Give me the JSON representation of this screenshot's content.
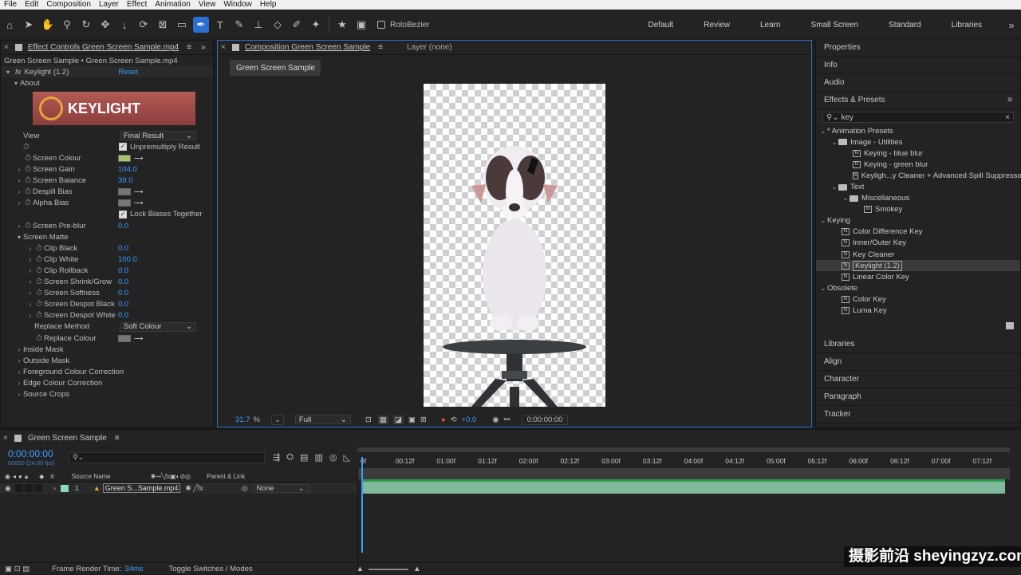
{
  "menu": [
    "File",
    "Edit",
    "Composition",
    "Layer",
    "Effect",
    "Animation",
    "View",
    "Window",
    "Help"
  ],
  "toolbar": {
    "rotobezier_label": "RotoBezier",
    "workspaces": [
      "Default",
      "Review",
      "Learn",
      "Small Screen",
      "Standard",
      "Libraries"
    ]
  },
  "effect_controls": {
    "tab_title": "Effect Controls Green Screen Sample.mp4",
    "subtitle": "Green Screen Sample • Green Screen Sample.mp4",
    "effect_name": "Keylight (1.2)",
    "reset_label": "Reset",
    "about_label": "About",
    "banner_text": "KEYLIGHT",
    "view_label": "View",
    "view_value": "Final Result",
    "unpremultiply_label": "Unpremultiply Result",
    "screen_colour_label": "Screen Colour",
    "screen_colour_swatch": "#a8c46a",
    "screen_gain_label": "Screen Gain",
    "screen_gain_value": "104.0",
    "screen_balance_label": "Screen Balance",
    "screen_balance_value": "39.0",
    "despill_bias_label": "Despill Bias",
    "alpha_bias_label": "Alpha Bias",
    "lock_biases_label": "Lock Biases Together",
    "screen_preblur_label": "Screen Pre-blur",
    "screen_preblur_value": "0.0",
    "screen_matte_label": "Screen Matte",
    "clip_black_label": "Clip Black",
    "clip_black_value": "0.0",
    "clip_white_label": "Clip White",
    "clip_white_value": "100.0",
    "clip_rollback_label": "Clip Rollback",
    "clip_rollback_value": "0.0",
    "shrink_grow_label": "Screen Shrink/Grow",
    "shrink_grow_value": "0.0",
    "softness_label": "Screen Softness",
    "softness_value": "0.0",
    "despot_black_label": "Screen Despot Black",
    "despot_black_value": "0.0",
    "despot_white_label": "Screen Despot White",
    "despot_white_value": "0.0",
    "replace_method_label": "Replace Method",
    "replace_method_value": "Soft Colour",
    "replace_colour_label": "Replace Colour",
    "groups": [
      "Inside Mask",
      "Outside Mask",
      "Foreground Colour Correction",
      "Edge Colour Correction",
      "Source Crops"
    ]
  },
  "composition": {
    "tab_title": "Composition Green Screen Sample",
    "layer_tab": "Layer (none)",
    "comp_button": "Green Screen Sample",
    "zoom": "31.7",
    "zoom_unit": "%",
    "resolution": "Full",
    "exposure": "+0.0",
    "timecode": "0:00:00:00"
  },
  "right_panel": {
    "sections_top": [
      "Properties",
      "Info",
      "Audio"
    ],
    "effects_title": "Effects & Presets",
    "search_value": "key",
    "tree": [
      {
        "label": "* Animation Presets",
        "level": 0,
        "kind": "group"
      },
      {
        "label": "Image - Utilities",
        "level": 1,
        "kind": "folder"
      },
      {
        "label": "Keying - blue blur",
        "level": 2,
        "kind": "fx"
      },
      {
        "label": "Keying - green blur",
        "level": 2,
        "kind": "fx"
      },
      {
        "label": "Keyligh...y Cleaner + Advanced Spill Suppressor",
        "level": 2,
        "kind": "fx"
      },
      {
        "label": "Text",
        "level": 1,
        "kind": "folder"
      },
      {
        "label": "Miscellaneous",
        "level": 2,
        "kind": "folder"
      },
      {
        "label": "Smokey",
        "level": 3,
        "kind": "fx"
      },
      {
        "label": "Keying",
        "level": 0,
        "kind": "group"
      },
      {
        "label": "Color Difference Key",
        "level": 1,
        "kind": "fx"
      },
      {
        "label": "Inner/Outer Key",
        "level": 1,
        "kind": "fx"
      },
      {
        "label": "Key Cleaner",
        "level": 1,
        "kind": "fx"
      },
      {
        "label": "Keylight (1.2)",
        "level": 1,
        "kind": "fx",
        "selected": true
      },
      {
        "label": "Linear Color Key",
        "level": 1,
        "kind": "fx"
      },
      {
        "label": "Obsolete",
        "level": 0,
        "kind": "group"
      },
      {
        "label": "Color Key",
        "level": 1,
        "kind": "fx"
      },
      {
        "label": "Luma Key",
        "level": 1,
        "kind": "fx"
      }
    ],
    "sections_bottom": [
      "Libraries",
      "Align",
      "Character",
      "Paragraph",
      "Tracker"
    ]
  },
  "timeline": {
    "tab_title": "Green Screen Sample",
    "timecode": "0:00:00:00",
    "frame_info": "00000 (24.00 fps)",
    "col_source": "Source Name",
    "col_parent": "Parent & Link",
    "col_hash": "#",
    "layer_num": "1",
    "layer_name": "Green S...Sample.mp4",
    "parent_value": "None",
    "ruler": [
      "0f",
      "00:12f",
      "01:00f",
      "01:12f",
      "02:00f",
      "02:12f",
      "03:00f",
      "03:12f",
      "04:00f",
      "04:12f",
      "05:00f",
      "05:12f",
      "06:00f",
      "06:12f",
      "07:00f",
      "07:12f"
    ],
    "render_label": "Frame Render Time:",
    "render_value": "34ms",
    "toggle_label": "Toggle Switches / Modes"
  },
  "watermark": "摄影前沿 sheyingzyz.com",
  "colors": {
    "accent": "#2d6ed3",
    "value_blue": "#3c9cff",
    "layer_bar": "#7fb89a",
    "track_green": "#2e9a4e"
  }
}
